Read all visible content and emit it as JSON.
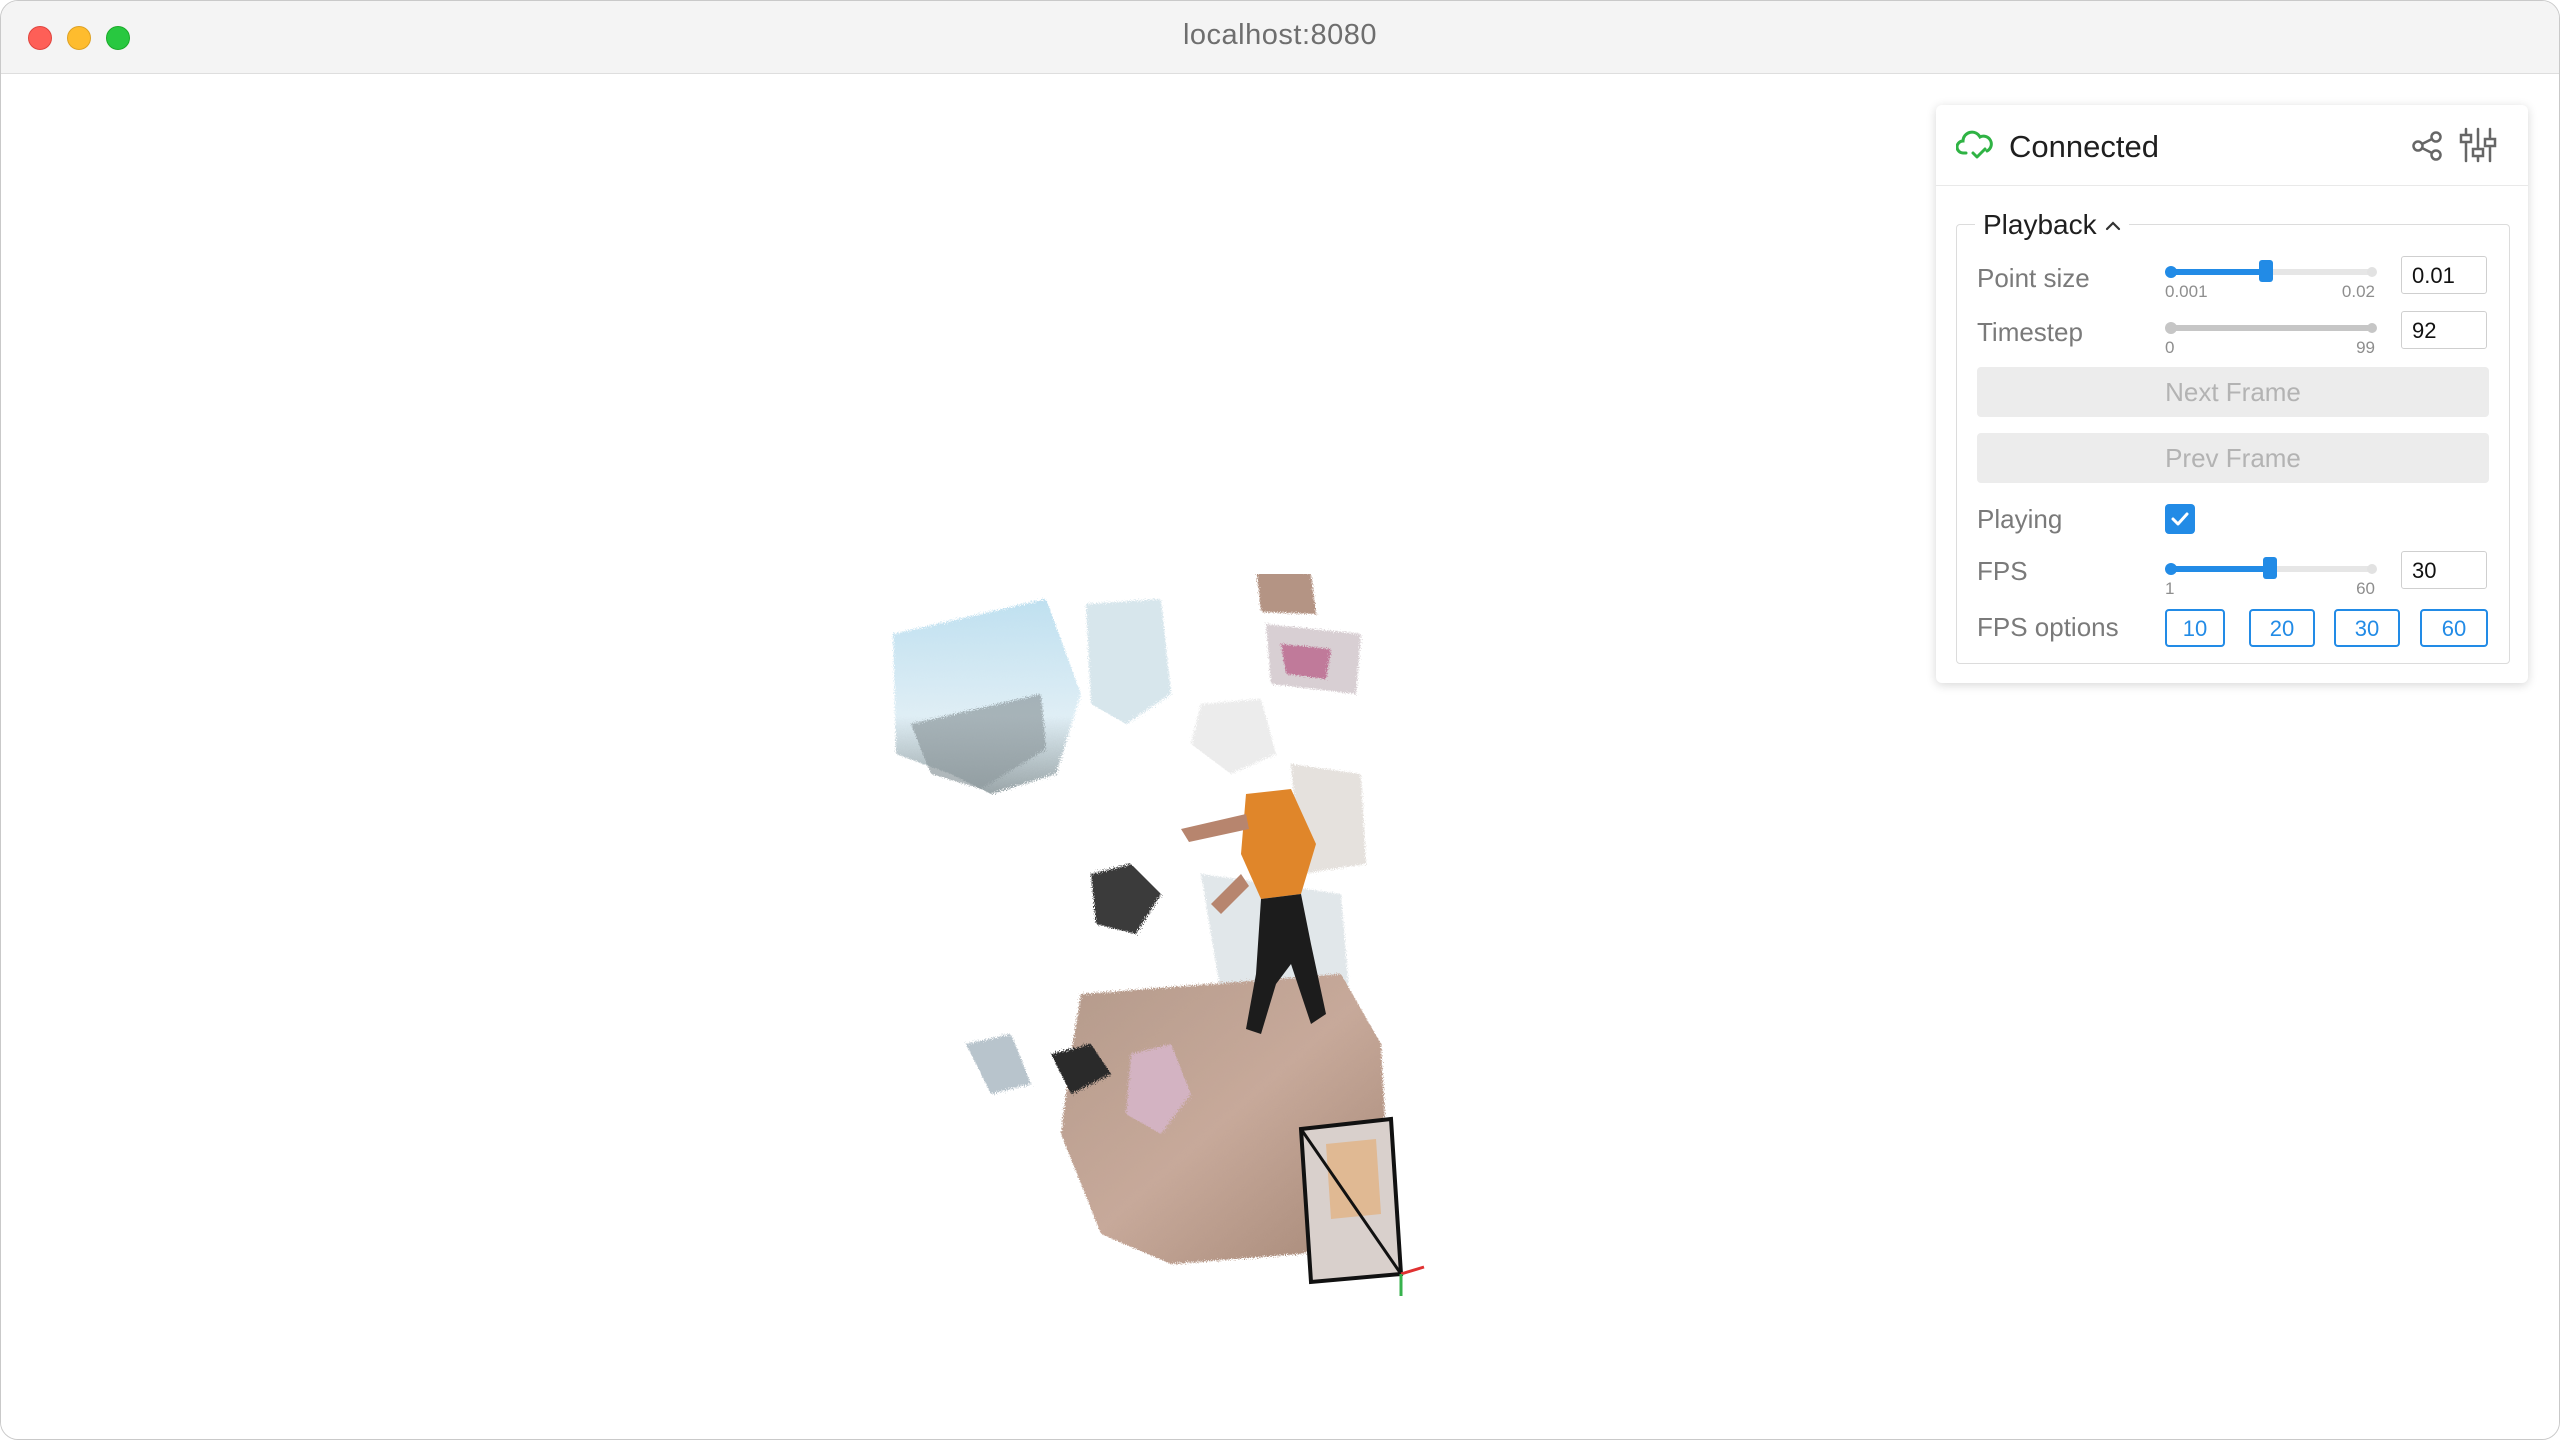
{
  "browser": {
    "url": "localhost:8080"
  },
  "panel": {
    "status": "Connected",
    "section": "Playback",
    "point_size": {
      "label": "Point size",
      "min": "0.001",
      "max": "0.02",
      "value": "0.01",
      "fraction": 0.47
    },
    "timestep": {
      "label": "Timestep",
      "min": "0",
      "max": "99",
      "value": "92",
      "fraction": 0.93
    },
    "next_frame": "Next Frame",
    "prev_frame": "Prev Frame",
    "playing": {
      "label": "Playing",
      "checked": true
    },
    "fps": {
      "label": "FPS",
      "min": "1",
      "max": "60",
      "value": "30",
      "fraction": 0.49
    },
    "fps_options": {
      "label": "FPS options",
      "options": [
        "10",
        "20",
        "30",
        "60"
      ]
    }
  },
  "colors": {
    "accent": "#228be6",
    "status_green": "#2fb344"
  }
}
